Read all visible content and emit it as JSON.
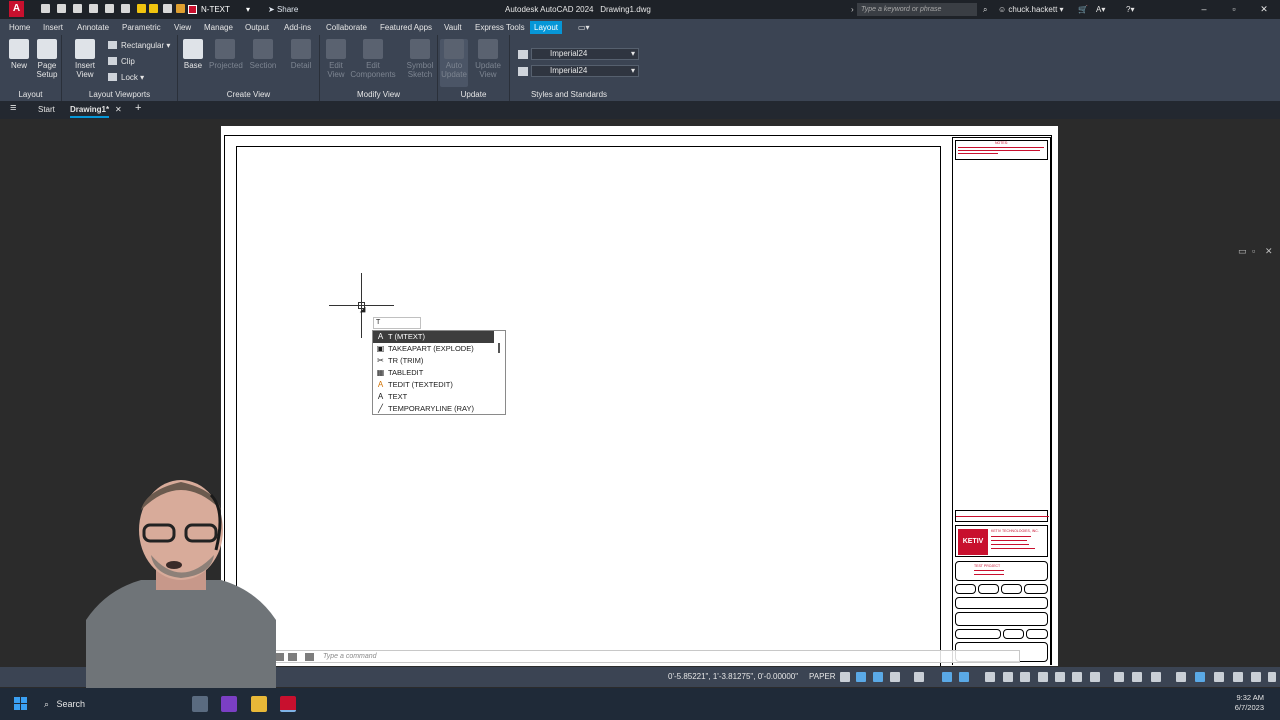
{
  "titlebar": {
    "workspace": "N-TEXT",
    "share": "Share",
    "app_title": "Autodesk AutoCAD 2024",
    "doc_title": "Drawing1.dwg",
    "search_placeholder": "Type a keyword or phrase",
    "user": "chuck.hackett"
  },
  "menu_tabs": [
    "Home",
    "Insert",
    "Annotate",
    "Parametric",
    "View",
    "Manage",
    "Output",
    "Add-ins",
    "Collaborate",
    "Featured Apps",
    "Vault",
    "Express Tools",
    "Layout"
  ],
  "active_tab": "Layout",
  "ribbon": {
    "layout_panel": {
      "label": "Layout",
      "new": "New",
      "page_setup": "Page Setup"
    },
    "viewports_panel": {
      "label": "Layout Viewports",
      "insert_view": "Insert View",
      "rectangular": "Rectangular",
      "clip": "Clip",
      "lock": "Lock"
    },
    "create_view_panel": {
      "label": "Create View",
      "base": "Base",
      "projected": "Projected",
      "section": "Section",
      "detail": "Detail"
    },
    "modify_view_panel": {
      "label": "Modify View",
      "edit_view": "Edit View",
      "edit_components": "Edit Components",
      "symbol_sketch": "Symbol Sketch"
    },
    "update_panel": {
      "label": "Update",
      "auto_update": "Auto Update",
      "update_view": "Update View"
    },
    "styles_panel": {
      "label": "Styles and Standards",
      "style1": "Imperial24",
      "style2": "Imperial24"
    }
  },
  "file_tabs": {
    "start": "Start",
    "drawing": "Drawing1*"
  },
  "dynamic_input": "T",
  "autocomplete": [
    {
      "label": "T (MTEXT)",
      "icon": "text-icon",
      "glyph": "A"
    },
    {
      "label": "TAKEAPART (EXPLODE)",
      "icon": "explode-icon",
      "glyph": "▣"
    },
    {
      "label": "TR (TRIM)",
      "icon": "trim-icon",
      "glyph": "✂"
    },
    {
      "label": "TABLEDIT",
      "icon": "table-icon",
      "glyph": "▦"
    },
    {
      "label": "TEDIT (TEXTEDIT)",
      "icon": "textedit-icon",
      "glyph": "A"
    },
    {
      "label": "TEXT",
      "icon": "text-icon",
      "glyph": "A"
    },
    {
      "label": "TEMPORARYLINE (RAY)",
      "icon": "ray-icon",
      "glyph": "╱"
    }
  ],
  "command_line": {
    "placeholder": "Type a command"
  },
  "statusbar": {
    "coords": "0'-5.85221\", 1'-3.81275\", 0'-0.00000\"",
    "space": "PAPER"
  },
  "titleblock": {
    "notes_title": "NOTES:",
    "company": "KETIV TECHNOLOGIES, INC.",
    "logo": "KETIV",
    "project": "TEST PROJECT"
  },
  "taskbar": {
    "search": "Search",
    "time": "9:32 AM",
    "date": "6/7/2023"
  },
  "colors": {
    "accent": "#0696d7",
    "brand_red": "#c8102e"
  }
}
